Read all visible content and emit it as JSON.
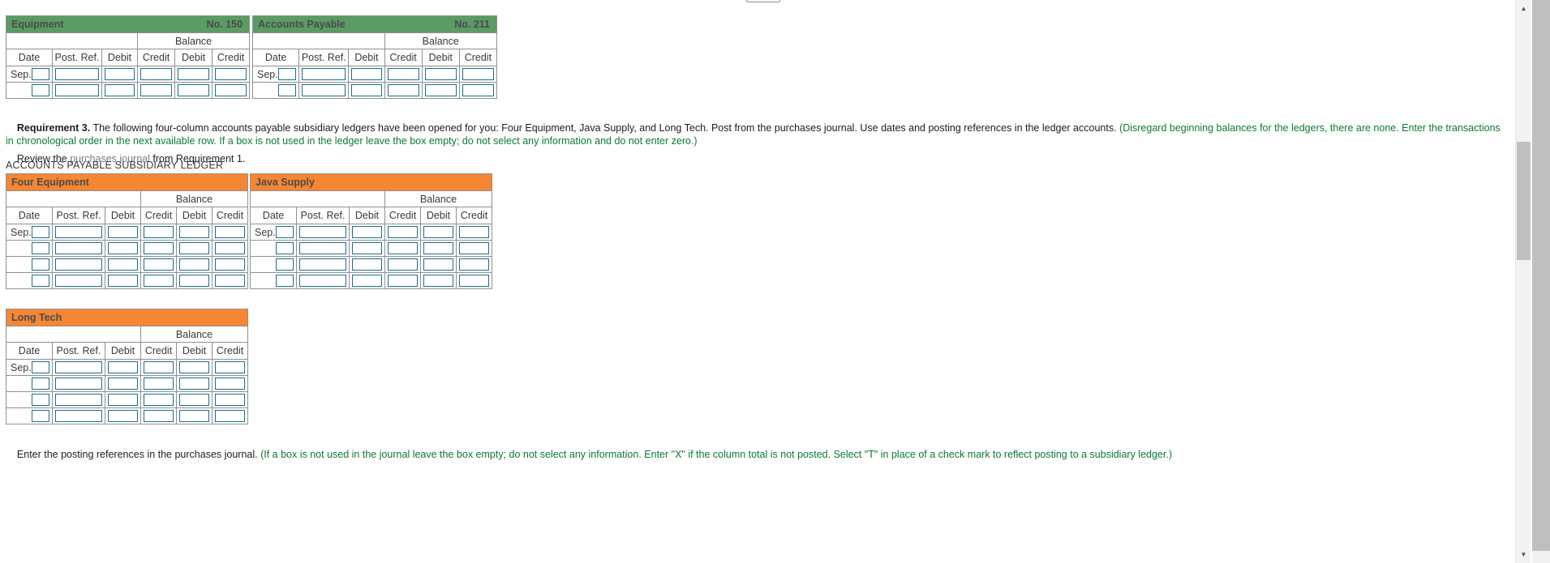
{
  "columns": {
    "date": "Date",
    "post_ref": "Post. Ref.",
    "debit": "Debit",
    "credit": "Credit",
    "balance": "Balance",
    "bal_debit": "Debit",
    "bal_credit": "Credit"
  },
  "date_label": "Sep.",
  "general_ledger": {
    "accounts": [
      {
        "name": "Equipment",
        "number": "No. 150",
        "rows": 2,
        "header_color": "#5a9c64"
      },
      {
        "name": "Accounts Payable",
        "number": "No. 211",
        "rows": 2,
        "header_color": "#5a9c64"
      }
    ]
  },
  "requirement": {
    "label": "Requirement 3.",
    "black_text": " The following four-column accounts payable subsidiary ledgers have been opened for you: Four Equipment, Java Supply, and Long Tech. Post from the purchases journal. Use dates and posting references in the ledger accounts. ",
    "green_text": "(Disregard beginning balances for the ledgers, there are none. Enter the transactions in chronological order in the next available row. If a box is not used in the ledger leave the box empty; do not select any information and do not enter zero.)"
  },
  "review_line": {
    "before": "Review the ",
    "link": "purchases journal",
    "after": " from Requirement 1."
  },
  "subsidiary_heading": "ACCOUNTS PAYABLE SUBSIDIARY LEDGER",
  "subsidiary_ledger": {
    "accounts": [
      {
        "name": "Four Equipment",
        "number": "",
        "rows": 4,
        "header_color": "#f58634"
      },
      {
        "name": "Java Supply",
        "number": "",
        "rows": 4,
        "header_color": "#f58634"
      },
      {
        "name": "Long Tech",
        "number": "",
        "rows": 4,
        "header_color": "#f58634"
      }
    ]
  },
  "footer": {
    "black_text": "Enter the posting references in the purchases journal. ",
    "green_text": "(If a box is not used in the journal leave the box empty; do not select any information. Enter \"X\" if the column total is not posted. Select \"T\" in place of a check mark to reflect posting to a subsidiary ledger.)"
  },
  "scrollbar": {
    "up_arrow": "▲",
    "down_arrow": "▼"
  }
}
